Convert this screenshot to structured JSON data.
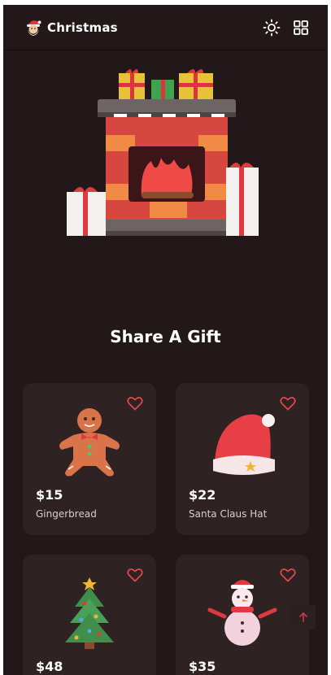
{
  "header": {
    "brand_name": "Christmas",
    "icons": {
      "logo": "santa-icon",
      "theme": "sun-icon",
      "grid": "grid-icon"
    }
  },
  "hero": {
    "image": "fireplace-with-gifts-illustration"
  },
  "section": {
    "title": "Share A Gift"
  },
  "products": [
    {
      "price": "$15",
      "name": "Gingerbread",
      "image": "gingerbread-man"
    },
    {
      "price": "$22",
      "name": "Santa Claus Hat",
      "image": "santa-hat"
    },
    {
      "price": "$48",
      "name": "",
      "image": "christmas-tree"
    },
    {
      "price": "$35",
      "name": "",
      "image": "snowman"
    }
  ],
  "colors": {
    "background": "#231819",
    "card": "#2e2223",
    "accent": "#e5484d"
  }
}
